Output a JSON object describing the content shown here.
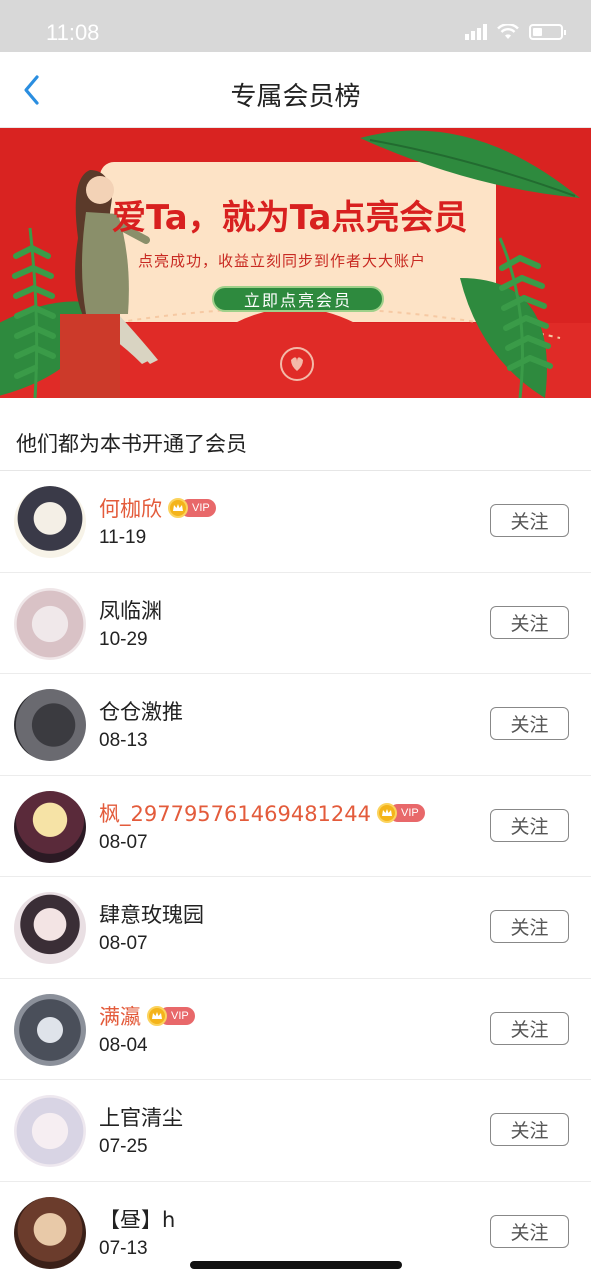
{
  "status_bar": {
    "time": "11:08"
  },
  "nav": {
    "title": "专属会员榜"
  },
  "banner": {
    "headline": "爱Ta，就为Ta点亮会员",
    "subline": "点亮成功，收益立刻同步到作者大大账户",
    "cta": "立即点亮会员"
  },
  "section": {
    "title": "他们都为本书开通了会员"
  },
  "vip_label": "VIP",
  "members": [
    {
      "name": "何枷欣",
      "date": "11-19",
      "vip": true,
      "follow": "关注"
    },
    {
      "name": "凤临渊",
      "date": "10-29",
      "vip": false,
      "follow": "关注"
    },
    {
      "name": "仓仓激推",
      "date": "08-13",
      "vip": false,
      "follow": "关注"
    },
    {
      "name": "枫_297795761469481244",
      "date": "08-07",
      "vip": true,
      "follow": "关注"
    },
    {
      "name": "肆意玫瑰园",
      "date": "08-07",
      "vip": false,
      "follow": "关注"
    },
    {
      "name": "满瀛",
      "date": "08-04",
      "vip": true,
      "follow": "关注"
    },
    {
      "name": "上官清尘",
      "date": "07-25",
      "vip": false,
      "follow": "关注"
    },
    {
      "name": "【昼】h",
      "date": "07-13",
      "vip": false,
      "follow": "关注"
    }
  ],
  "colors": {
    "accent": "#2a8ee0",
    "vip_name": "#e35b3b",
    "banner_red": "#d92321",
    "banner_green": "#2e8a3e"
  }
}
